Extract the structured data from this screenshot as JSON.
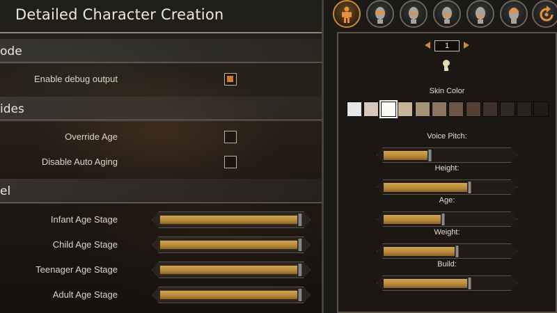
{
  "page": {
    "title": "Detailed Character Creation"
  },
  "sections": [
    {
      "heading": "ode",
      "rows": [
        {
          "label": "Enable debug output",
          "checked": true
        }
      ]
    },
    {
      "heading": "ides",
      "rows": [
        {
          "label": "Override Age",
          "checked": false
        },
        {
          "label": "Disable Auto Aging",
          "checked": false
        }
      ]
    },
    {
      "heading": "el",
      "sliders": [
        {
          "label": "Infant Age Stage",
          "value": 1.0
        },
        {
          "label": "Child Age Stage",
          "value": 1.0
        },
        {
          "label": "Teenager Age Stage",
          "value": 1.0
        },
        {
          "label": "Adult Age Stage",
          "value": 1.0
        }
      ]
    }
  ],
  "right_panel": {
    "avatars": [
      {
        "icon": "full-body-icon",
        "active": true
      },
      {
        "icon": "head-icon-1",
        "active": false
      },
      {
        "icon": "head-icon-2",
        "active": false
      },
      {
        "icon": "head-icon-3",
        "active": false
      },
      {
        "icon": "head-icon-4",
        "active": false
      },
      {
        "icon": "head-icon-5",
        "active": false
      },
      {
        "icon": "refresh-icon",
        "active": false
      }
    ],
    "stepper_value": "1",
    "skin_color_label": "Skin Color",
    "skin_colors": [
      "#e6e6e6",
      "#d9c6b6",
      "#fbfbf7",
      "#c7b597",
      "#a69276",
      "#8e7562",
      "#6e5546",
      "#543f33",
      "#40302a",
      "#2e2823",
      "#26221f",
      "#1f1c19"
    ],
    "selected_skin_index": 2,
    "sliders": [
      {
        "label": "Voice Pitch:",
        "value": 0.37
      },
      {
        "label": "Height:",
        "value": 0.68
      },
      {
        "label": "Age:",
        "value": 0.47
      },
      {
        "label": "Weight:",
        "value": 0.58
      },
      {
        "label": "Build:",
        "value": 0.68
      }
    ]
  }
}
